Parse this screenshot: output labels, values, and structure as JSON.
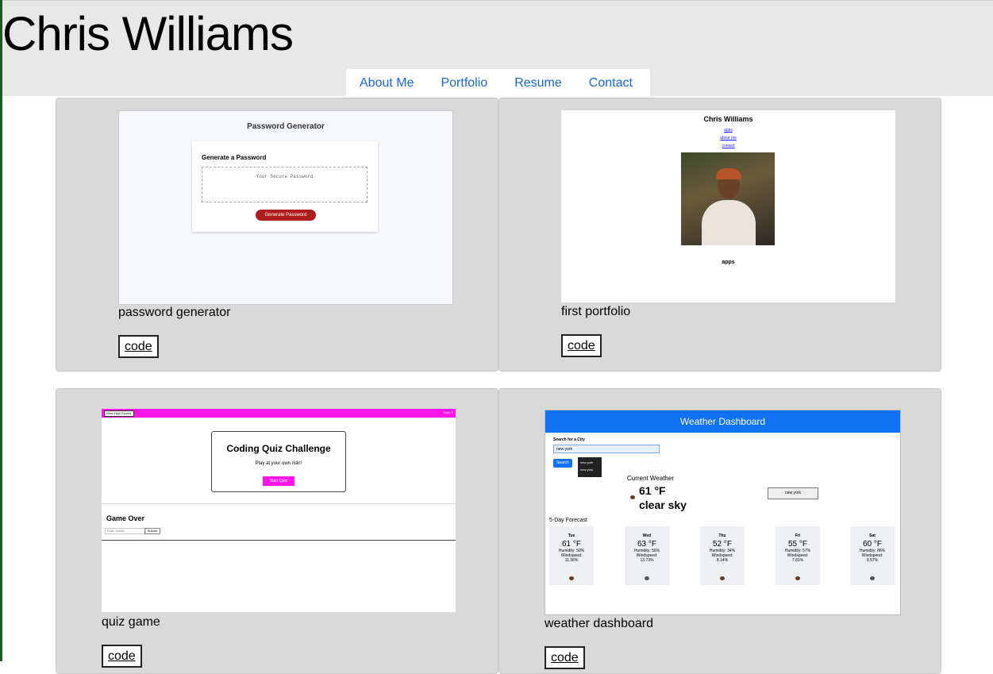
{
  "site": {
    "title": "Chris Williams"
  },
  "nav": [
    "About Me",
    "Portfolio",
    "Resume",
    "Contact"
  ],
  "projects": [
    {
      "caption": "password generator",
      "code_label": "code",
      "screenshot": {
        "title": "Password Generator",
        "heading": "Generate a Password",
        "placeholder": "Your Secure Password",
        "button": "Generate Password"
      }
    },
    {
      "caption": "first portfolio",
      "code_label": "code",
      "screenshot": {
        "name": "Chris Williams",
        "links": [
          "apps",
          "about me",
          "contact"
        ],
        "section": "apps"
      }
    },
    {
      "caption": "quiz game",
      "code_label": "code",
      "screenshot": {
        "highscores": "View High Scores",
        "timer": "Time: 0",
        "title": "Coding Quiz Challenge",
        "subtitle": "Play at your own risk!!",
        "start": "Start Quiz",
        "game_over": "Game Over",
        "initials_placeholder": "Enter Initials",
        "submit": "Submit"
      }
    },
    {
      "caption": "weather dashboard",
      "code_label": "code",
      "screenshot": {
        "title": "Weather Dashboard",
        "search_label": "Search for a City",
        "search_value": "new york",
        "search_button": "Search",
        "dropdown": [
          "new york",
          "new york"
        ],
        "current_label": "Current Weather",
        "current_temp": "61 °F",
        "current_desc": "clear sky",
        "history_button": "new york",
        "forecast_label": "5-Day Forecast",
        "forecast": [
          {
            "day": "Tue",
            "temp": "61 °F",
            "humidity": "Humidity: 50%",
            "wind_label": "Windspeed:",
            "wind": "11.36%"
          },
          {
            "day": "Wed",
            "temp": "63 °F",
            "humidity": "Humidity: 56%",
            "wind_label": "Windspeed:",
            "wind": "13.73%"
          },
          {
            "day": "Thu",
            "temp": "52 °F",
            "humidity": "Humidity: 34%",
            "wind_label": "Windspeed:",
            "wind": "8.14%"
          },
          {
            "day": "Fri",
            "temp": "55 °F",
            "humidity": "Humidity: 57%",
            "wind_label": "Windspeed:",
            "wind": "7.81%"
          },
          {
            "day": "Sat",
            "temp": "60 °F",
            "humidity": "Humidity: 86%",
            "wind_label": "Windspeed:",
            "wind": "9.57%"
          }
        ]
      }
    }
  ]
}
